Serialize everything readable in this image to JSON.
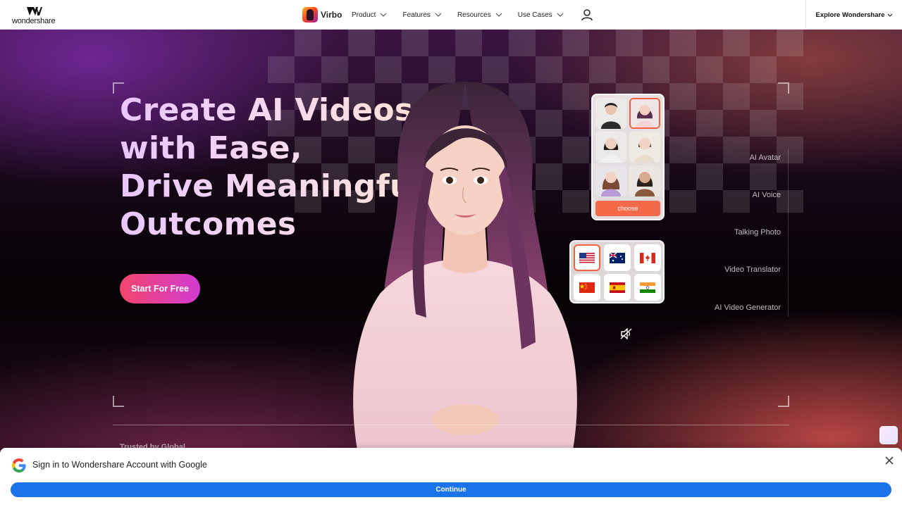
{
  "nav": {
    "logo_text": "wondershare",
    "brand_name": "Virbo",
    "menu": [
      {
        "label": "Product"
      },
      {
        "label": "Features"
      },
      {
        "label": "Resources"
      },
      {
        "label": "Use Cases"
      }
    ],
    "explore_label": "Explore Wondershare"
  },
  "hero": {
    "headline_lines": [
      "Create AI Videos",
      "with Ease,",
      "Drive Meaningful",
      "Outcomes"
    ],
    "cta_label": "Start For Free",
    "picker_button": "choose",
    "side_items": [
      "AI Avatar",
      "AI Voice",
      "Talking Photo",
      "Video Translator",
      "AI Video Generator"
    ],
    "trusted_text": "Trusted by Global",
    "flags": [
      "us-flag",
      "au-flag",
      "ca-flag",
      "cn-flag",
      "es-flag",
      "in-flag"
    ]
  },
  "google_signin": {
    "title": "Sign in to Wondershare Account with Google",
    "continue_label": "Continue"
  },
  "colors": {
    "cta_start": "#f3456b",
    "cta_end": "#d23bd2",
    "accent": "#f4694a",
    "google_blue": "#1a73e8"
  }
}
